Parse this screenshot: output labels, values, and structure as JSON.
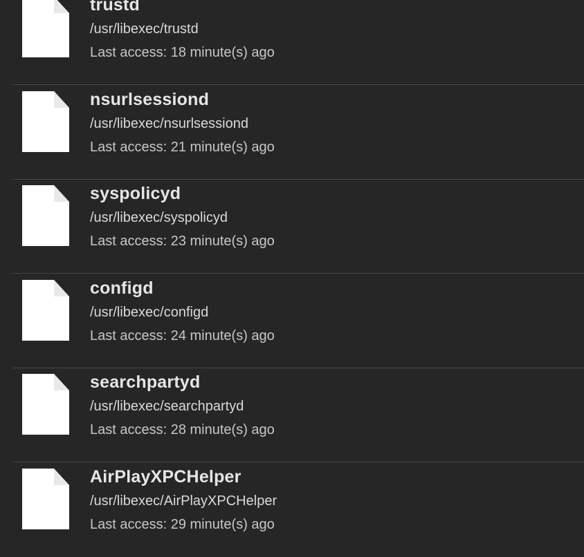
{
  "items": [
    {
      "name": "trustd",
      "path": "/usr/libexec/trustd",
      "access": "Last access: 18 minute(s) ago",
      "icon": "document-icon"
    },
    {
      "name": "nsurlsessiond",
      "path": "/usr/libexec/nsurlsessiond",
      "access": "Last access: 21 minute(s) ago",
      "icon": "document-icon"
    },
    {
      "name": "syspolicyd",
      "path": "/usr/libexec/syspolicyd",
      "access": "Last access: 23 minute(s) ago",
      "icon": "document-icon"
    },
    {
      "name": "configd",
      "path": "/usr/libexec/configd",
      "access": "Last access: 24 minute(s) ago",
      "icon": "document-icon"
    },
    {
      "name": "searchpartyd",
      "path": "/usr/libexec/searchpartyd",
      "access": "Last access: 28 minute(s) ago",
      "icon": "document-icon"
    },
    {
      "name": "AirPlayXPCHelper",
      "path": "/usr/libexec/AirPlayXPCHelper",
      "access": "Last access: 29 minute(s) ago",
      "icon": "document-icon"
    }
  ],
  "colors": {
    "background": "#262626",
    "divider": "#464646",
    "title": "#e6e6e6",
    "subtitle": "#dadada",
    "icon": "#ffffff"
  }
}
